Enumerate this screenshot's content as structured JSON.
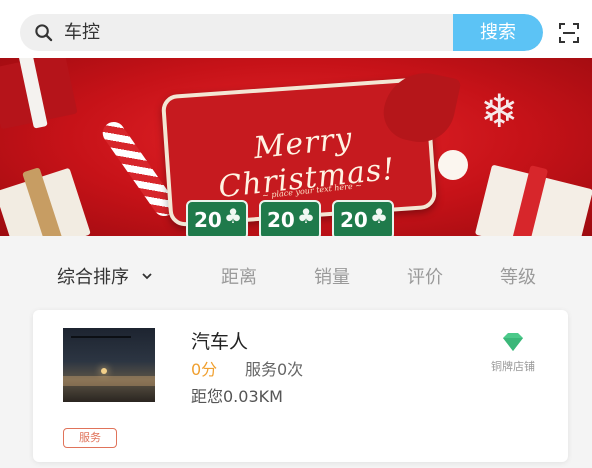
{
  "search": {
    "value": "车控",
    "button_label": "搜索",
    "search_icon": "search-icon",
    "scan_icon": "scan-icon"
  },
  "banner": {
    "title": "Merry Christmas!",
    "subtitle": "~ place your text here ~",
    "badges": [
      "20",
      "20",
      "20"
    ]
  },
  "filters": [
    {
      "label": "综合排序",
      "active": true,
      "icon": "chevron-down-icon"
    },
    {
      "label": "距离",
      "active": false
    },
    {
      "label": "销量",
      "active": false
    },
    {
      "label": "评价",
      "active": false
    },
    {
      "label": "等级",
      "active": false
    }
  ],
  "shop": {
    "name": "汽车人",
    "score": "0分",
    "service_count": "服务0次",
    "distance": "距您0.03KM",
    "level_label": "铜牌店铺",
    "level_icon": "diamond-icon",
    "level_color": "#4cc98a",
    "tag": "服务"
  },
  "colors": {
    "accent": "#5cc3f5",
    "score": "#f0a030",
    "tag": "#e0735a"
  }
}
